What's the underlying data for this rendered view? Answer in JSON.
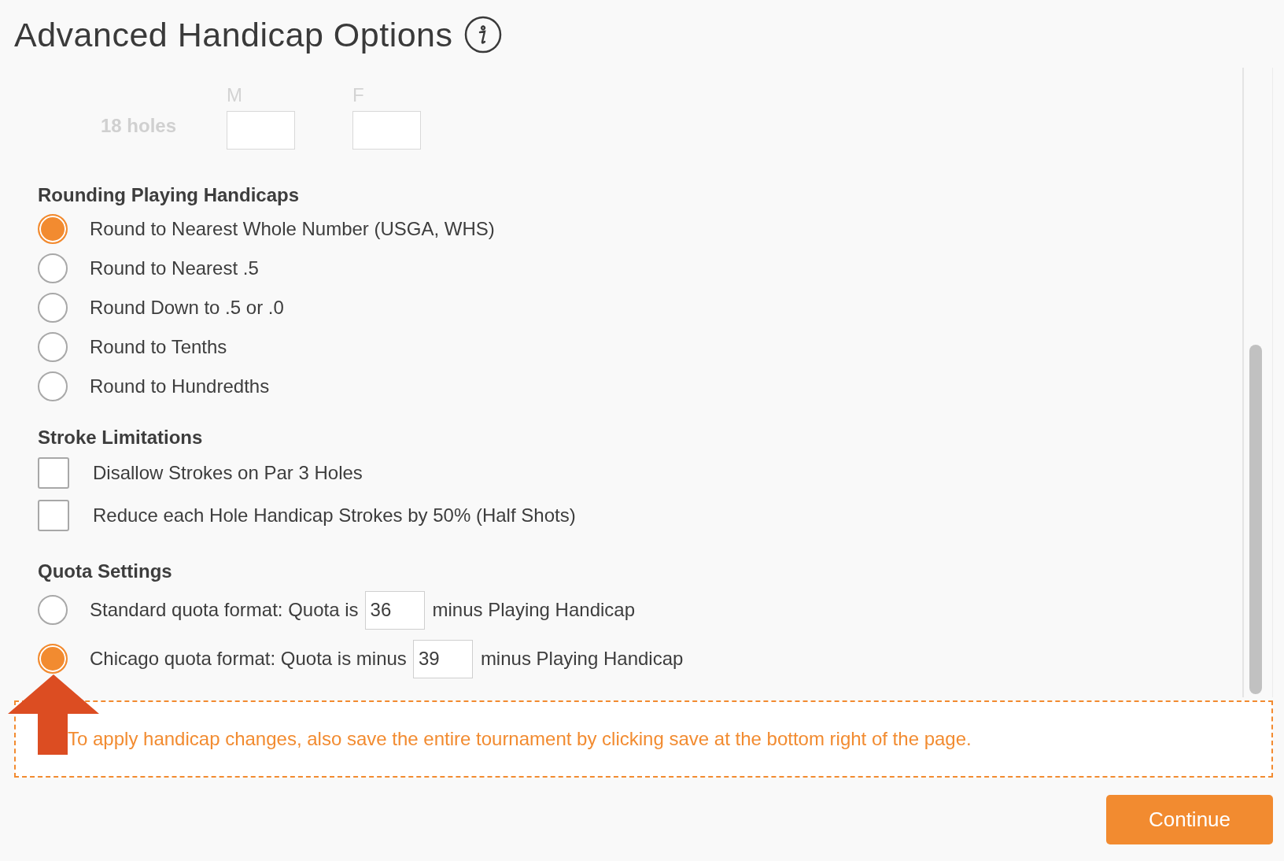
{
  "title": "Advanced Handicap Options",
  "holes_row": {
    "label": "18 holes",
    "columns": [
      {
        "label": "M"
      },
      {
        "label": "F"
      }
    ]
  },
  "rounding": {
    "heading": "Rounding Playing Handicaps",
    "options": [
      {
        "label": "Round to Nearest Whole Number (USGA, WHS)",
        "selected": true
      },
      {
        "label": "Round to Nearest .5",
        "selected": false
      },
      {
        "label": "Round Down to .5 or .0",
        "selected": false
      },
      {
        "label": "Round to Tenths",
        "selected": false
      },
      {
        "label": "Round to Hundredths",
        "selected": false
      }
    ]
  },
  "stroke_limitations": {
    "heading": "Stroke Limitations",
    "options": [
      {
        "label": "Disallow Strokes on Par 3 Holes",
        "checked": false
      },
      {
        "label": "Reduce each Hole Handicap Strokes by 50% (Half Shots)",
        "checked": false
      }
    ]
  },
  "quota": {
    "heading": "Quota Settings",
    "options": [
      {
        "before": "Standard quota format: Quota is",
        "value": "36",
        "after": "minus Playing Handicap",
        "selected": false
      },
      {
        "before": "Chicago quota format: Quota is minus",
        "value": "39",
        "after": "minus Playing Handicap",
        "selected": true
      }
    ]
  },
  "notice": {
    "text": "To apply handicap changes, also save the entire tournament by clicking save at the bottom right of the page."
  },
  "continue_button": "Continue"
}
